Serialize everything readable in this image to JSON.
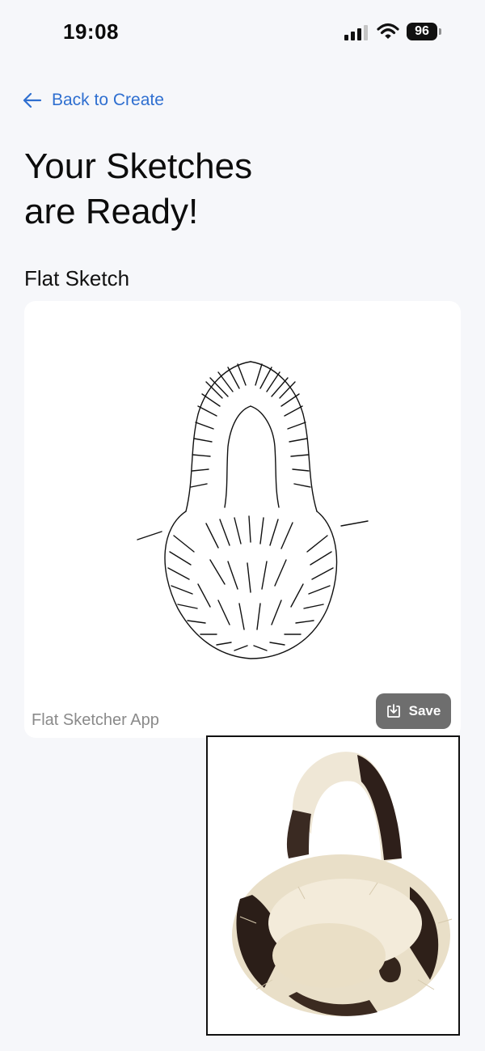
{
  "status_bar": {
    "time": "19:08",
    "battery": "96",
    "icons": [
      "signal-icon",
      "wifi-icon",
      "battery-icon"
    ]
  },
  "nav": {
    "back_label": "Back to Create",
    "back_icon": "arrow-left-icon"
  },
  "page": {
    "title_line1": "Your Sketches",
    "title_line2": "are Ready!",
    "section_label": "Flat Sketch"
  },
  "sketch_card": {
    "watermark": "Flat Sketcher App",
    "save_label": "Save",
    "save_icon": "download-icon"
  },
  "colors": {
    "accent": "#2f6fd0",
    "background": "#f6f7fa",
    "save_button": "#6e6e6e"
  }
}
